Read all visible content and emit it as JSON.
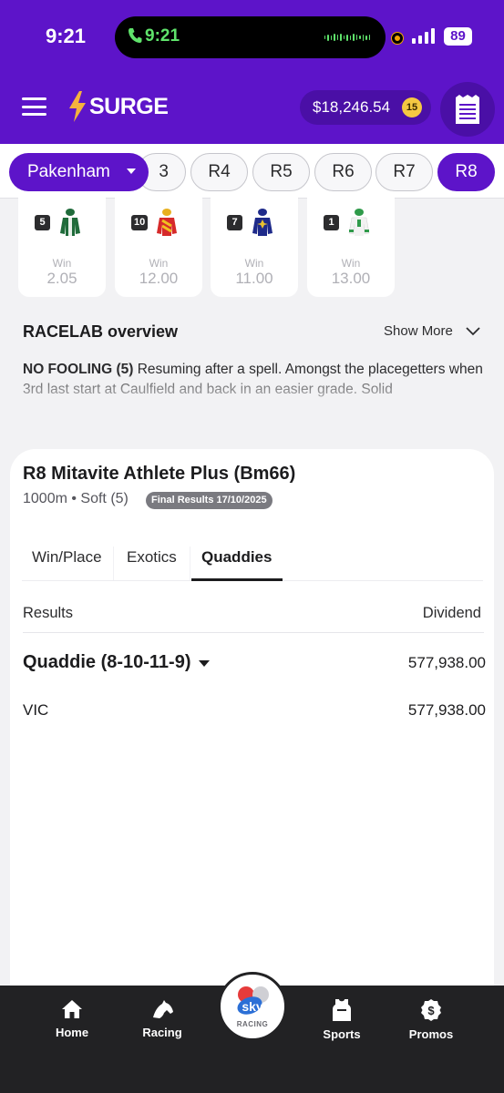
{
  "status_bar": {
    "time": "9:21",
    "call_time": "9:21",
    "battery": "89"
  },
  "header": {
    "logo_text": "SURGE",
    "balance": "$18,246.54",
    "balance_badge": "15",
    "brand_color": "#5d14c9"
  },
  "race_nav": {
    "venue": "Pakenham",
    "races": [
      "3",
      "R4",
      "R5",
      "R6",
      "R7",
      "R8"
    ],
    "active_race": "R8"
  },
  "runners": [
    {
      "number": "5",
      "win_label": "Win",
      "odds": "2.05"
    },
    {
      "number": "10",
      "win_label": "Win",
      "odds": "12.00"
    },
    {
      "number": "7",
      "win_label": "Win",
      "odds": "11.00"
    },
    {
      "number": "1",
      "win_label": "Win",
      "odds": "13.00"
    }
  ],
  "racelab": {
    "title": "RACELAB overview",
    "show_more": "Show More",
    "runner_name": "NO FOOLING (5)",
    "text": " Resuming after a spell. Amongst the placegetters when 3rd last start at Caulfield and back in an easier grade. Solid"
  },
  "race": {
    "title": "R8 Mitavite Athlete Plus (Bm66)",
    "meta": "1000m • Soft (5)",
    "badge": "Final Results 17/10/2025"
  },
  "tabs": [
    "Win/Place",
    "Exotics",
    "Quaddies"
  ],
  "results": {
    "results_header": "Results",
    "dividend_header": "Dividend",
    "bet_name": "Quaddie (8-10-11-9)",
    "bet_dividend": "577,938.00",
    "state": "VIC",
    "state_dividend": "577,938.00"
  },
  "bottom_nav": {
    "home": "Home",
    "racing": "Racing",
    "sky_label": "RACING",
    "sports": "Sports",
    "promos": "Promos"
  }
}
